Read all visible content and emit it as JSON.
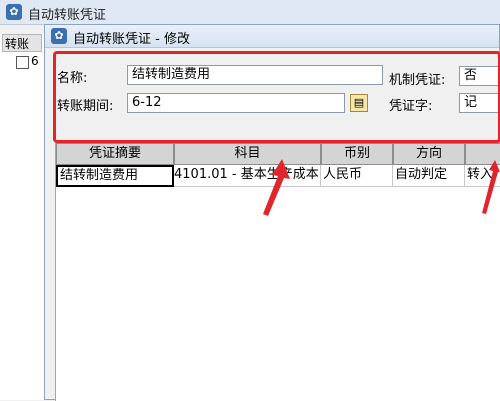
{
  "background_window": {
    "title": "自动转账凭证",
    "column_header": "转账",
    "row_char": "6"
  },
  "dialog": {
    "title": "自动转账凭证 - 修改",
    "form": {
      "name_label": "名称:",
      "name_value": "结转制造费用",
      "period_label": "转账期间:",
      "period_value": "6-12",
      "machine_voucher_label": "机制凭证:",
      "machine_voucher_value": "否",
      "voucher_word_label": "凭证字:",
      "voucher_word_value": "记"
    },
    "grid": {
      "columns": [
        "凭证摘要",
        "科目",
        "币别",
        "方向",
        ""
      ],
      "rows": [
        [
          "结转制造费用",
          "4101.01 - 基本生产成本",
          "人民币",
          "自动判定",
          "转入"
        ]
      ]
    }
  },
  "annotation": {
    "highlight_color": "#e0262b",
    "arrow_color": "#e0262b"
  }
}
